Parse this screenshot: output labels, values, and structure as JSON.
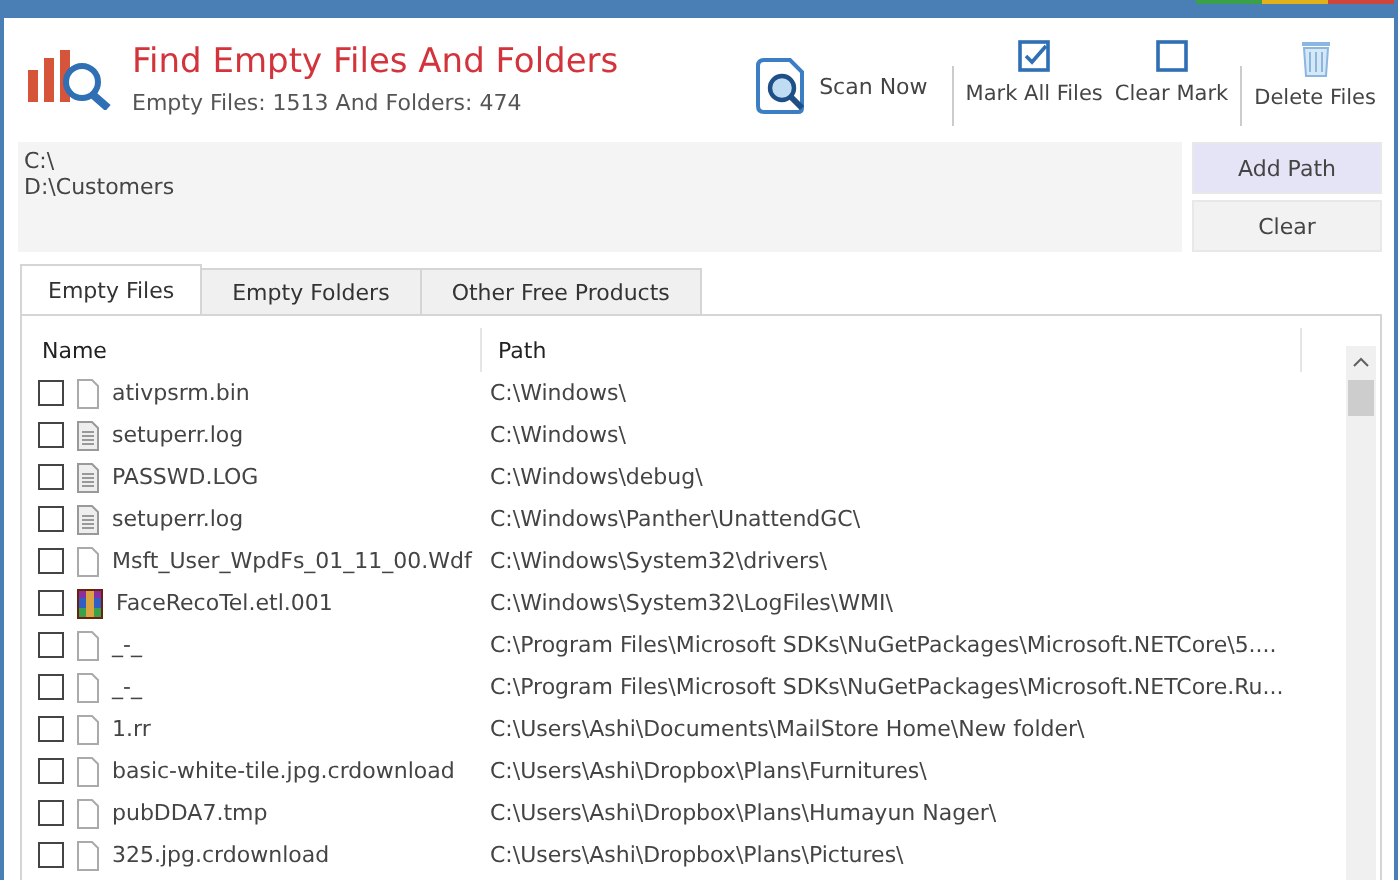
{
  "header": {
    "title": "Find Empty Files And Folders",
    "subtitle": "Empty Files: 1513 And Folders: 474"
  },
  "toolbar": [
    {
      "kind": "scan",
      "label": "Scan Now"
    },
    {
      "kind": "mark",
      "label": "Mark All Files"
    },
    {
      "kind": "clear",
      "label": "Clear Mark"
    },
    {
      "kind": "delete",
      "label": "Delete Files"
    }
  ],
  "paths": [
    "C:\\",
    "D:\\Customers"
  ],
  "path_buttons": [
    {
      "label": "Add Path",
      "highlighted": true
    },
    {
      "label": "Clear",
      "highlighted": false
    }
  ],
  "tabs": [
    {
      "label": "Empty Files",
      "selected": true
    },
    {
      "label": "Empty Folders",
      "selected": false
    },
    {
      "label": "Other Free Products",
      "selected": false
    }
  ],
  "table": {
    "columns": [
      "Name",
      "Path"
    ],
    "rows": [
      {
        "checked": false,
        "kind": "file",
        "name": "ativpsrm.bin",
        "path": "C:\\Windows\\"
      },
      {
        "checked": false,
        "kind": "text",
        "name": "setuperr.log",
        "path": "C:\\Windows\\"
      },
      {
        "checked": false,
        "kind": "text",
        "name": "PASSWD.LOG",
        "path": "C:\\Windows\\debug\\"
      },
      {
        "checked": false,
        "kind": "text",
        "name": "setuperr.log",
        "path": "C:\\Windows\\Panther\\UnattendGC\\"
      },
      {
        "checked": false,
        "kind": "file",
        "name": "Msft_User_WpdFs_01_11_00.Wdf",
        "path": "C:\\Windows\\System32\\drivers\\"
      },
      {
        "checked": false,
        "kind": "archive",
        "name": "FaceRecoTel.etl.001",
        "path": "C:\\Windows\\System32\\LogFiles\\WMI\\"
      },
      {
        "checked": false,
        "kind": "file",
        "name": "_-_",
        "path": "C:\\Program Files\\Microsoft SDKs\\NuGetPackages\\Microsoft.NETCore\\5...."
      },
      {
        "checked": false,
        "kind": "file",
        "name": "_-_",
        "path": "C:\\Program Files\\Microsoft SDKs\\NuGetPackages\\Microsoft.NETCore.Ru..."
      },
      {
        "checked": false,
        "kind": "file",
        "name": "1.rr",
        "path": "C:\\Users\\Ashi\\Documents\\MailStore Home\\New folder\\"
      },
      {
        "checked": false,
        "kind": "file",
        "name": "basic-white-tile.jpg.crdownload",
        "path": "C:\\Users\\Ashi\\Dropbox\\Plans\\Furnitures\\"
      },
      {
        "checked": false,
        "kind": "file",
        "name": "pubDDA7.tmp",
        "path": "C:\\Users\\Ashi\\Dropbox\\Plans\\Humayun Nager\\"
      },
      {
        "checked": false,
        "kind": "file",
        "name": "325.jpg.crdownload",
        "path": "C:\\Users\\Ashi\\Dropbox\\Plans\\Pictures\\"
      }
    ]
  }
}
